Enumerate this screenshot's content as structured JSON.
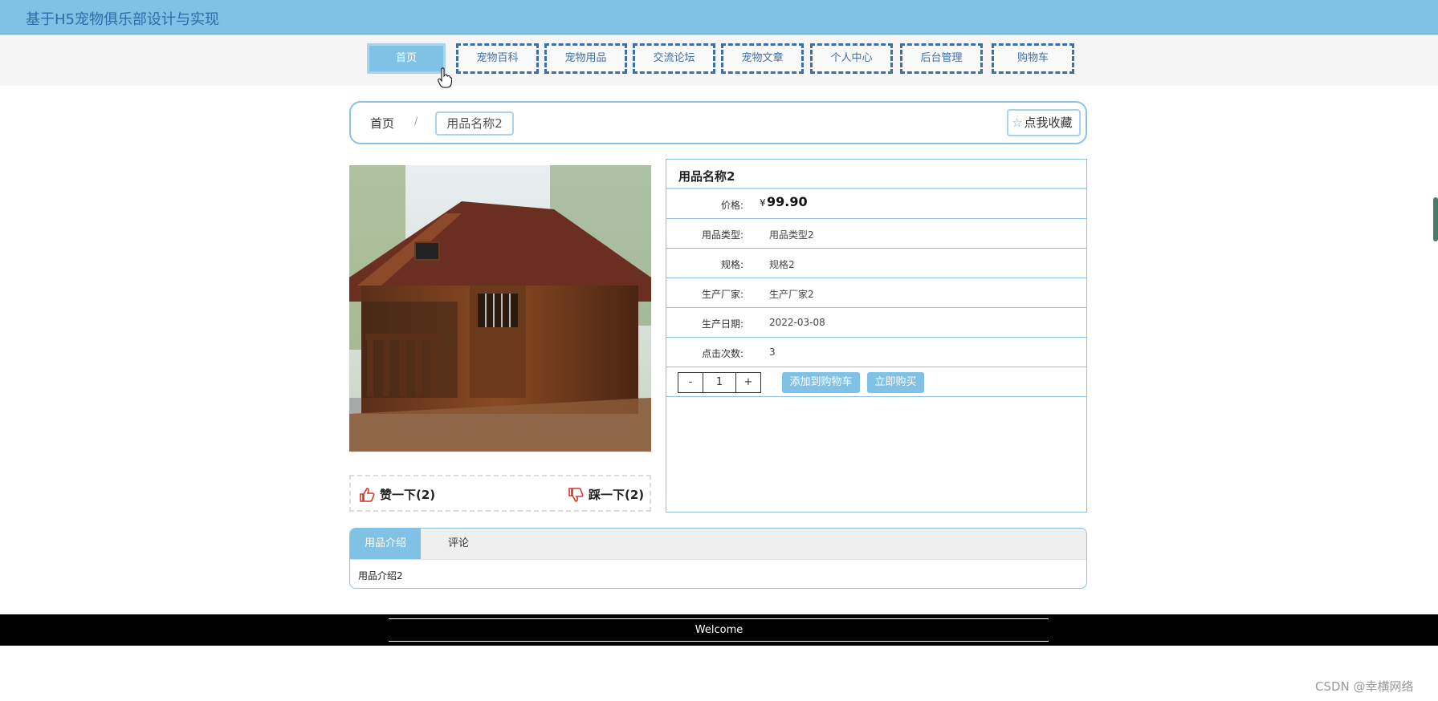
{
  "header": {
    "site_title": "基于H5宠物俱乐部设计与实现"
  },
  "nav": {
    "items": [
      {
        "label": "首页",
        "active": true
      },
      {
        "label": "宠物百科"
      },
      {
        "label": "宠物用品"
      },
      {
        "label": "交流论坛"
      },
      {
        "label": "宠物文章"
      },
      {
        "label": "个人中心"
      },
      {
        "label": "后台管理"
      },
      {
        "label": "购物车"
      }
    ]
  },
  "breadcrumb": {
    "home": "首页",
    "separator": "/",
    "current": "用品名称2"
  },
  "favorite_label": "点我收藏",
  "votes": {
    "like": "赞一下(2)",
    "dislike": "踩一下(2)"
  },
  "product": {
    "name": "用品名称2",
    "price_label": "价格:",
    "price_symbol": "¥",
    "price": "99.90",
    "fields": [
      {
        "label": "用品类型:",
        "value": "用品类型2"
      },
      {
        "label": "规格:",
        "value": "规格2"
      },
      {
        "label": "生产厂家:",
        "value": "生产厂家2"
      },
      {
        "label": "生产日期:",
        "value": "2022-03-08"
      },
      {
        "label": "点击次数:",
        "value": "3"
      }
    ]
  },
  "purchase": {
    "minus": "-",
    "quantity": "1",
    "plus": "+",
    "add_to_cart": "添加到购物车",
    "buy_now": "立即购买"
  },
  "tabs": {
    "items": [
      {
        "label": "用品介绍",
        "active": true
      },
      {
        "label": "评论"
      }
    ],
    "content": "用品介绍2"
  },
  "footer": {
    "text": "Welcome"
  },
  "watermark": "CSDN @幸横网络",
  "colors": {
    "accent": "#80c1e6",
    "nav_border": "#3d6ea8",
    "title_text": "#2e6aa8"
  }
}
